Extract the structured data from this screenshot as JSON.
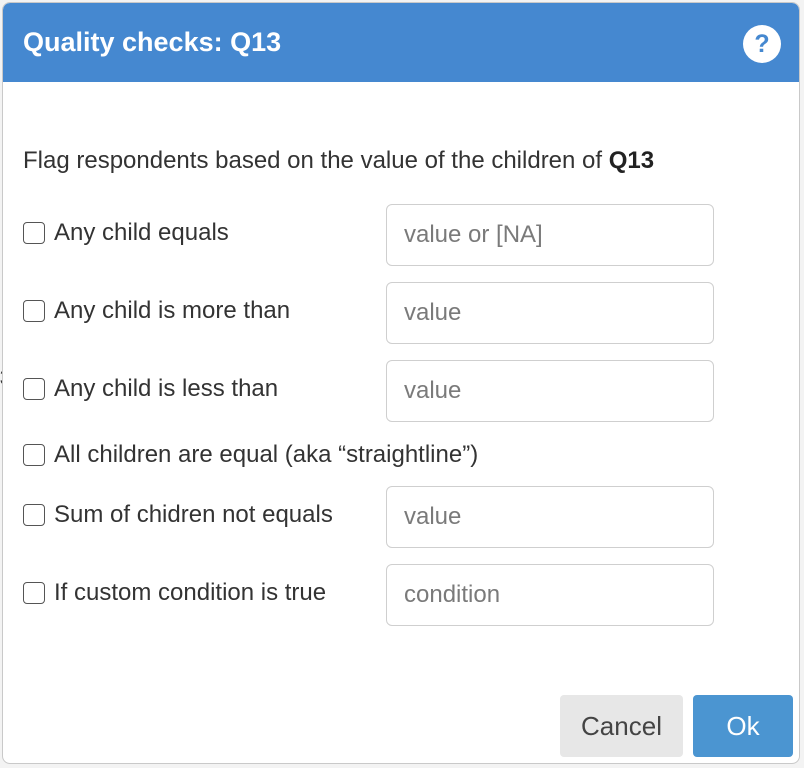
{
  "dialog": {
    "title": "Quality checks: Q13",
    "help_icon": "?",
    "intro_prefix": "Flag respondents based on the value of the children of ",
    "intro_bold": "Q13"
  },
  "checks": [
    {
      "label": "Any child equals",
      "checked": false,
      "placeholder": "value or [NA]",
      "value": ""
    },
    {
      "label": "Any child is more than",
      "checked": false,
      "placeholder": "value",
      "value": ""
    },
    {
      "label": "Any child is less than",
      "checked": false,
      "placeholder": "value",
      "value": ""
    },
    {
      "label": "All children are equal (aka “straightline”)",
      "checked": false
    },
    {
      "label": "Sum of chidren not equals",
      "checked": false,
      "placeholder": "value",
      "value": ""
    },
    {
      "label": "If custom condition is true",
      "checked": false,
      "placeholder": "condition",
      "value": ""
    }
  ],
  "buttons": {
    "cancel": "Cancel",
    "ok": "Ok"
  },
  "colors": {
    "header": "#4588d0",
    "ok_button": "#4b95d1",
    "cancel_button": "#e7e7e7"
  }
}
